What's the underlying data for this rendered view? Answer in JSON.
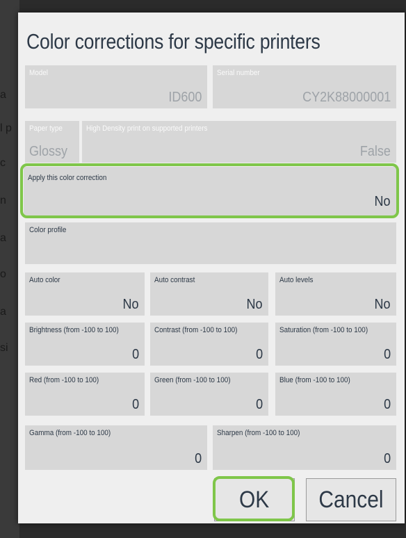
{
  "dialog": {
    "title": "Color corrections for specific printers"
  },
  "fields": {
    "model": {
      "label": "Model",
      "value": "ID600"
    },
    "serial": {
      "label": "Serial number",
      "value": "CY2K88000001"
    },
    "paper_type": {
      "label": "Paper type",
      "value": "Glossy"
    },
    "high_density": {
      "label": "High Density print on supported printers",
      "value": "False"
    },
    "apply": {
      "label": "Apply this color correction",
      "value": "No"
    },
    "color_profile": {
      "label": "Color profile",
      "value": ""
    },
    "auto_color": {
      "label": "Auto color",
      "value": "No"
    },
    "auto_contrast": {
      "label": "Auto contrast",
      "value": "No"
    },
    "auto_levels": {
      "label": "Auto levels",
      "value": "No"
    },
    "brightness": {
      "label": "Brightness (from -100 to 100)",
      "value": "0"
    },
    "contrast": {
      "label": "Contrast (from -100 to 100)",
      "value": "0"
    },
    "saturation": {
      "label": "Saturation (from -100 to 100)",
      "value": "0"
    },
    "red": {
      "label": "Red (from -100 to 100)",
      "value": "0"
    },
    "green": {
      "label": "Green (from -100 to 100)",
      "value": "0"
    },
    "blue": {
      "label": "Blue (from -100 to 100)",
      "value": "0"
    },
    "gamma": {
      "label": "Gamma (from -100 to 100)",
      "value": "0"
    },
    "sharpen": {
      "label": "Sharpen (from -100 to 100)",
      "value": "0"
    }
  },
  "buttons": {
    "ok": "OK",
    "cancel": "Cancel"
  },
  "background_fragments": [
    "a",
    "l p",
    "c",
    "n",
    "a",
    "o",
    "a",
    "si"
  ],
  "colors": {
    "highlight": "#7fc64a",
    "dialog_bg": "#efefef",
    "field_bg": "#d7d7d7",
    "text_dark": "#2d3947"
  }
}
